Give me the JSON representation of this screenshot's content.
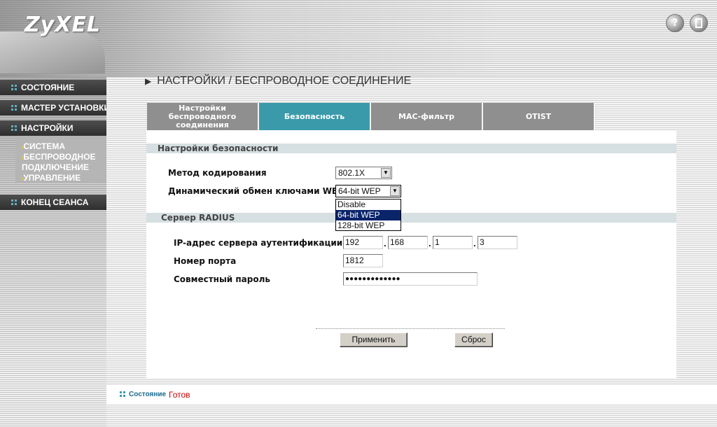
{
  "brand": {
    "logo": "ZyXEL"
  },
  "header": {
    "help_icon": "?",
    "exit_icon": "exit-icon"
  },
  "sidebar": {
    "items": [
      {
        "label": "СОСТОЯНИЕ"
      },
      {
        "label": "МАСТЕР УСТАНОВКИ"
      },
      {
        "label": "НАСТРОЙКИ"
      },
      {
        "label": "КОНЕЦ СЕАНСА"
      }
    ],
    "submenu": [
      {
        "label": "СИСТЕМА"
      },
      {
        "label": "БЕСПРОВОДНОЕ"
      },
      {
        "label": "ПОДКЛЮЧЕНИЕ"
      },
      {
        "label": "УПРАВЛЕНИЕ"
      }
    ]
  },
  "page": {
    "title": "НАСТРОЙКИ / БЕСПРОВОДНОЕ СОЕДИНЕНИЕ"
  },
  "tabs": [
    {
      "label_lines": [
        "Настройки",
        "беспроводного",
        "соединения"
      ],
      "active": false
    },
    {
      "label": "Безопасность",
      "active": true
    },
    {
      "label": "МАС-фильтр",
      "active": false
    },
    {
      "label": "OTIST",
      "active": false
    }
  ],
  "security": {
    "section_title": "Настройки безопасности",
    "encoding_label": "Метод кодирования",
    "encoding_value": "802.1X",
    "key_exchange_label": "Динамический обмен ключами WEP",
    "key_exchange_value": "64-bit WEP",
    "key_exchange_options": [
      "Disable",
      "64-bit WEP",
      "128-bit WEP"
    ],
    "key_exchange_selected": "64-bit WEP"
  },
  "radius": {
    "section_title": "Сервер RADIUS",
    "ip_label": "IP-адрес сервера аутентификации",
    "ip": [
      "192",
      "168",
      "1",
      "3"
    ],
    "port_label": "Номер порта",
    "port": "1812",
    "secret_label": "Совместный пароль",
    "secret": "●●●●●●●●●●●●●"
  },
  "actions": {
    "apply": "Применить",
    "reset": "Сброс"
  },
  "status": {
    "label": "Состояние",
    "value": "Готов"
  },
  "colors": {
    "accent": "#3a9aaa",
    "status_value": "#cc0000",
    "status_label": "#1a6a8a"
  }
}
